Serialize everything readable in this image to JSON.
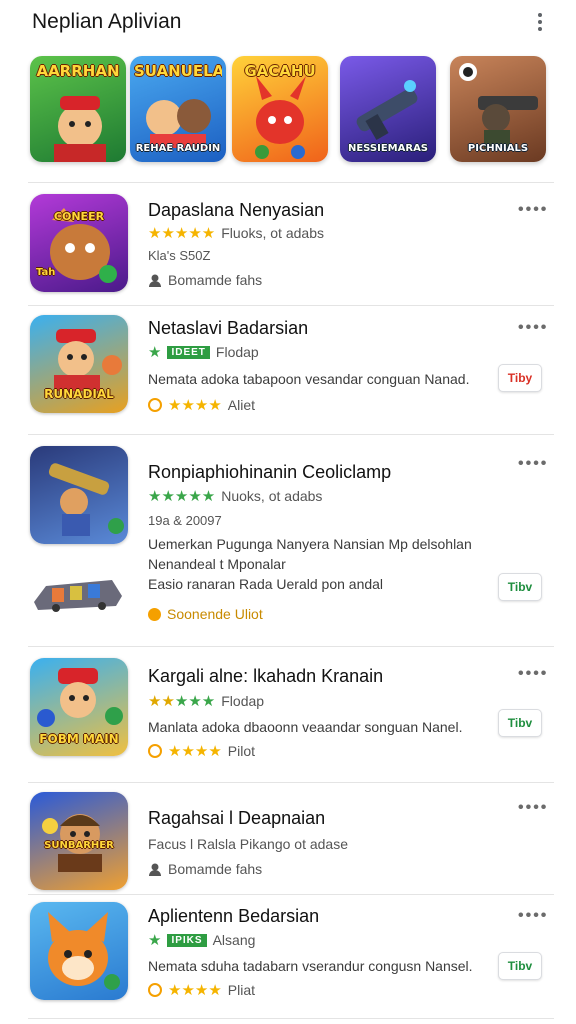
{
  "header": {
    "title": "Neplian Aplivian",
    "menu_icon": "more-vert-icon"
  },
  "banners": [
    {
      "top_text": "AARRHAN",
      "bottom_text": "",
      "bg": "#2f9a3c"
    },
    {
      "top_text": "SUANUELA",
      "bottom_text": "REHAE RAUDIN",
      "bg": "#2a7de0"
    },
    {
      "top_text": "GACAHU",
      "bottom_text": "",
      "bg": "#f07b1a"
    },
    {
      "top_text": "",
      "bottom_text": "NESSIEMARAS",
      "bg": "#4b3bb0"
    },
    {
      "top_text": "",
      "bottom_text": "PICHNIALS",
      "bg": "#8a4a2a"
    }
  ],
  "apps": [
    {
      "title": "Dapaslana Nenyasian",
      "rating_text": "Fluoks, ot adabs",
      "meta": "Kla's S50Z",
      "dev": "Bomamde fahs",
      "icon_text": "CONEER",
      "icon_sub": "Tah"
    },
    {
      "title": "Netaslavi Badarsian",
      "rating_badge": "IDEET",
      "rating_text": "Flodap",
      "desc": "Nemata adoka tabapoon vesandar conguan Nanad.",
      "sub_rating": "Aliet",
      "icon_text": "RUNADIAL",
      "button": "Tiby"
    },
    {
      "title": "Ronpiaphiohinanin Ceoliclamp",
      "rating_text": "Nuoks, ot adabs",
      "meta": "19a & 20097",
      "desc1": "Uemerkan Pugunga Nanyera Nansian Mp delsohlan",
      "desc2": "Nenandeal t Mponalar",
      "desc3": "Easio ranaran Rada Uerald pon andal",
      "dev": "Soonende Uliot",
      "button": "Tibv"
    },
    {
      "title": "Kargali alne: lkahadn Kranain",
      "rating_text": "Flodap",
      "desc": "Manlata adoka dbaoonn veaandar songuan Nanel.",
      "sub_rating": "Pilot",
      "icon_text": "FOBM MAIN",
      "button": "Tibv"
    },
    {
      "title": "Ragahsai l Deapnaian",
      "meta": "Facus l Ralsla Pikango ot adase",
      "dev": "Bomamde fahs",
      "icon_text": "SUNBARHER"
    },
    {
      "title": "Aplientenn Bedarsian",
      "rating_badge": "IPIKS",
      "rating_text": "Alsang",
      "desc": "Nemata sduha tadabarn vserandur congusn Nansel.",
      "sub_rating": "Pliat",
      "button": "Tibv"
    }
  ],
  "colors": {
    "star_gold": "#f5b400",
    "star_green": "#3aa64a",
    "badge_green": "#2e9d42",
    "button_red": "#d93025",
    "button_green": "#1e8e3e"
  }
}
